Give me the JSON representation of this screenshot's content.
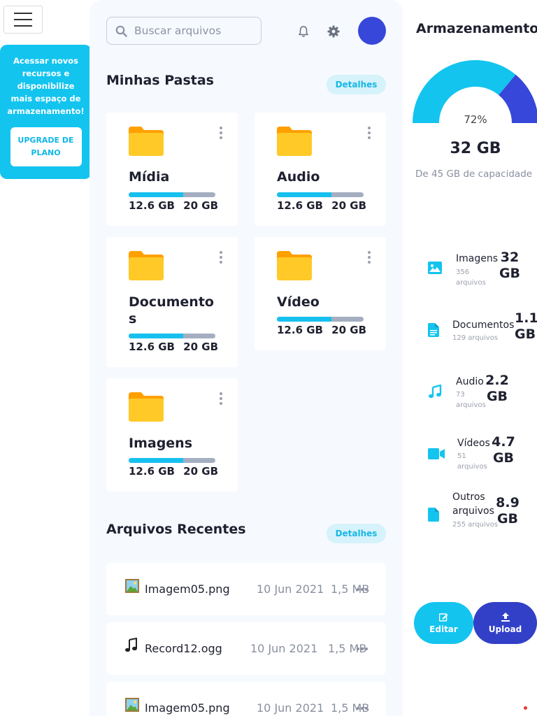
{
  "sidebar": {
    "promo_text": "Acessar novos recursos e disponibilize mais espaço de armazenamento!",
    "upgrade_button": "UPGRADE DE PLANO"
  },
  "header": {
    "search_placeholder": "Buscar arquivos",
    "icons": [
      "menu-icon",
      "search-icon",
      "bell-icon",
      "gear-icon"
    ]
  },
  "folders_section": {
    "title": "Minhas Pastas",
    "details_label": "Detalhes",
    "folders": [
      {
        "name": "Mídia",
        "used": "12.6 GB",
        "total": "20 GB",
        "fraction": 0.63
      },
      {
        "name": "Audio",
        "used": "12.6 GB",
        "total": "20 GB",
        "fraction": 0.63
      },
      {
        "name": "Documentos",
        "used": "12.6 GB",
        "total": "20 GB",
        "fraction": 0.63
      },
      {
        "name": "Vídeo",
        "used": "12.6 GB",
        "total": "20 GB",
        "fraction": 0.63
      },
      {
        "name": "Imagens",
        "used": "12.6 GB",
        "total": "20 GB",
        "fraction": 0.63
      }
    ]
  },
  "recent_section": {
    "title": "Arquivos Recentes",
    "details_label": "Detalhes",
    "files": [
      {
        "icon": "image-file-icon",
        "name": "Imagem05.png",
        "date": "10 Jun 2021",
        "size": "1,5 MB"
      },
      {
        "icon": "music-note-icon",
        "name": "Record12.ogg",
        "date": "10 Jun 2021",
        "size": "1,5 MB"
      },
      {
        "icon": "image-file-icon",
        "name": "Imagem05.png",
        "date": "10 Jun 2021",
        "size": "1,5 MB"
      }
    ]
  },
  "storage": {
    "title": "Armazenamento",
    "percent_label": "72%",
    "used_fraction": 0.72,
    "used": "32 GB",
    "capacity": "De 45 GB de capacidade",
    "colors": {
      "used": "#13c4ef",
      "rest": "#3647d9"
    },
    "categories": [
      {
        "icon": "image-icon",
        "name": "Imagens",
        "count": "356 arquivos",
        "size": "32 GB"
      },
      {
        "icon": "document-icon",
        "name": "Documentos",
        "count": "129 arquivos",
        "size": "1.1 GB"
      },
      {
        "icon": "music-icon",
        "name": "Audio",
        "count": "73 arquivos",
        "size": "2.2 GB"
      },
      {
        "icon": "video-icon",
        "name": "Vídeos",
        "count": "51 arquivos",
        "size": "4.7 GB"
      },
      {
        "icon": "file-icon",
        "name": "Outros arquivos",
        "count": "255 arquivos",
        "size": "8.9 GB"
      }
    ],
    "edit_label": "Editar",
    "upload_label": "Upload"
  }
}
